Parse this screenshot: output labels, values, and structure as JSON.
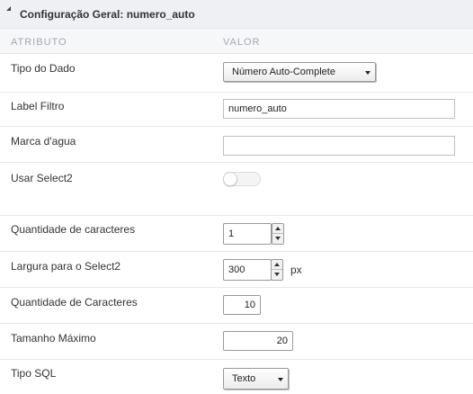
{
  "header": {
    "title": "Configuração Geral: numero_auto"
  },
  "columns": {
    "attribute": "ATRIBUTO",
    "value": "VALOR"
  },
  "fields": {
    "tipo_dado": {
      "label": "Tipo do Dado",
      "value": "Número Auto-Complete"
    },
    "label_filtro": {
      "label": "Label Filtro",
      "value": "numero_auto"
    },
    "marca_agua": {
      "label": "Marca d'agua",
      "value": ""
    },
    "usar_select2": {
      "label": "Usar Select2",
      "checked": false
    },
    "qtd_caracteres": {
      "label": "Quantidade de caracteres",
      "value": "1"
    },
    "largura_select2": {
      "label": "Largura para o Select2",
      "value": "300",
      "unit": "px"
    },
    "qtd_caracteres_2": {
      "label": "Quantidade de Caracteres",
      "value": "10"
    },
    "tamanho_maximo": {
      "label": "Tamanho Máximo",
      "value": "20"
    },
    "tipo_sql": {
      "label": "Tipo SQL",
      "value": "Texto"
    }
  }
}
